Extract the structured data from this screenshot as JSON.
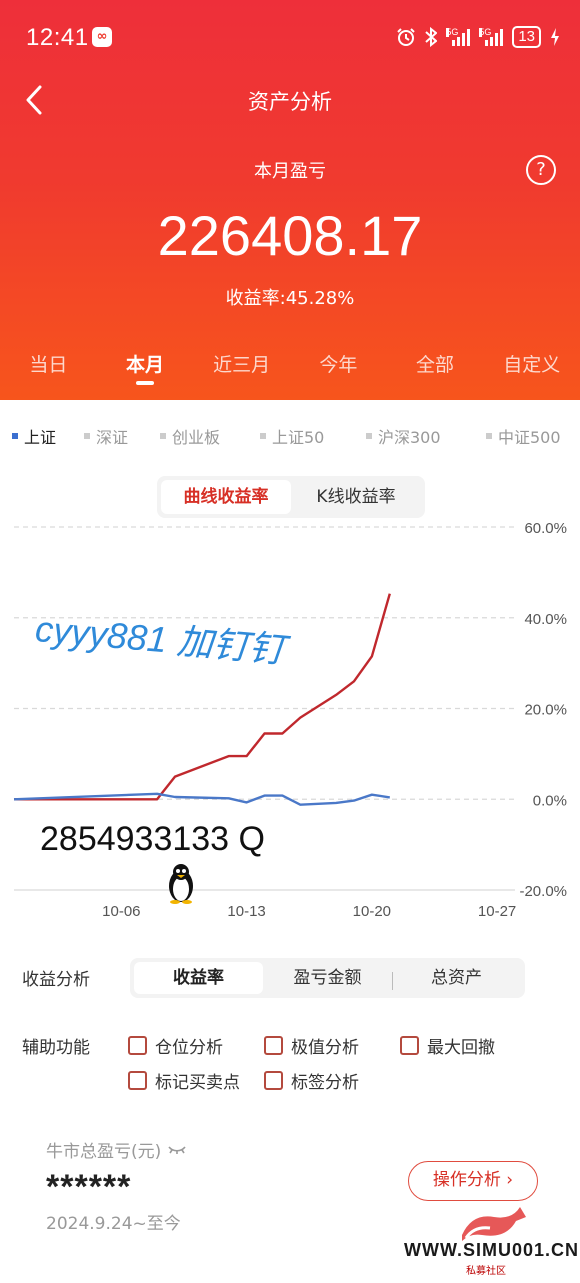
{
  "status_bar": {
    "time": "12:41",
    "notif_icon": "app-notification-icon",
    "battery": "13",
    "network": [
      "5G",
      "5G"
    ]
  },
  "nav": {
    "title": "资产分析",
    "back_icon": "chevron-left-icon"
  },
  "summary": {
    "label": "本月盈亏",
    "help_icon": "question-circle-icon",
    "help_glyph": "?",
    "value": "226408.17",
    "yield_label": "收益率:45.28%"
  },
  "period_tabs": [
    "当日",
    "本月",
    "近三月",
    "今年",
    "全部",
    "自定义"
  ],
  "active_period": "本月",
  "index_tabs": [
    "上证",
    "深证",
    "创业板",
    "上证50",
    "沪深300",
    "中证500"
  ],
  "active_index": "上证",
  "chart_toggle": [
    "曲线收益率",
    "K线收益率"
  ],
  "chart_data": {
    "type": "line",
    "y_ticks": [
      "60.0%",
      "40.0%",
      "20.0%",
      "0.0%",
      "-20.0%"
    ],
    "x_ticks": [
      "10-06",
      "10-13",
      "10-20",
      "10-27"
    ],
    "ylim": [
      -20,
      60
    ],
    "xlim": [
      "2024-09-30",
      "2024-10-28"
    ],
    "grid": true,
    "series": [
      {
        "color": "#c0282d",
        "points": [
          [
            "2024-09-30",
            0
          ],
          [
            "2024-10-08",
            0
          ],
          [
            "2024-10-09",
            5
          ],
          [
            "2024-10-12",
            9.5
          ],
          [
            "2024-10-13",
            9.5
          ],
          [
            "2024-10-14",
            14.5
          ],
          [
            "2024-10-15",
            14.5
          ],
          [
            "2024-10-16",
            18
          ],
          [
            "2024-10-18",
            23
          ],
          [
            "2024-10-19",
            26
          ],
          [
            "2024-10-20",
            31.5
          ],
          [
            "2024-10-21",
            45.3
          ]
        ]
      },
      {
        "color": "#4a78c8",
        "points": [
          [
            "2024-09-30",
            0
          ],
          [
            "2024-10-08",
            1.2
          ],
          [
            "2024-10-09",
            0.5
          ],
          [
            "2024-10-12",
            0.2
          ],
          [
            "2024-10-13",
            -0.7
          ],
          [
            "2024-10-14",
            0.8
          ],
          [
            "2024-10-15",
            0.8
          ],
          [
            "2024-10-16",
            -1.2
          ],
          [
            "2024-10-18",
            -0.8
          ],
          [
            "2024-10-19",
            -0.3
          ],
          [
            "2024-10-20",
            1
          ],
          [
            "2024-10-21",
            0.4
          ]
        ]
      }
    ]
  },
  "overlay": {
    "watermark": "cyyy881  加钉钉",
    "contact": "2854933133    Q"
  },
  "profit_analysis": {
    "label": "收益分析",
    "options": [
      "收益率",
      "盈亏金额",
      "总资产"
    ],
    "active": "收益率"
  },
  "aux": {
    "label": "辅助功能",
    "options": [
      "仓位分析",
      "极值分析",
      "最大回撤",
      "标记买卖点",
      "标签分析"
    ]
  },
  "bull": {
    "label": "牛市总盈亏(元)",
    "hidden_icon": "eye-closed-icon",
    "value": "******",
    "date_range": "2024.9.24~至今"
  },
  "op_button": "操作分析 ›",
  "site": {
    "name": "WWW.SIMU001.CN",
    "sub": "私募社区"
  }
}
